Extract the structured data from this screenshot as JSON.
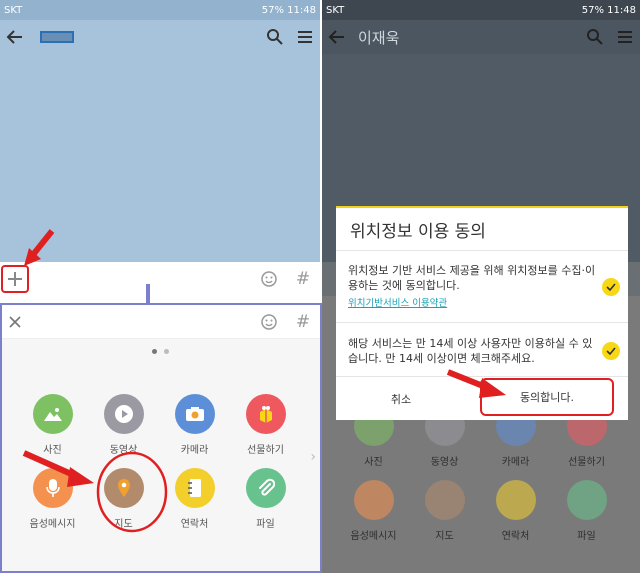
{
  "left": {
    "status": {
      "carrier": "SKT",
      "battery": "57%",
      "time": "11:48"
    },
    "input": {
      "emoji_icon": "emoji-icon",
      "hash_label": "#"
    },
    "drawer": {
      "hash_label": "#",
      "items": [
        {
          "label": "사진",
          "color": "#7dc163"
        },
        {
          "label": "동영상",
          "color": "#9b9aa2"
        },
        {
          "label": "카메라",
          "color": "#5d8fd8"
        },
        {
          "label": "선물하기",
          "color": "#f0585f"
        },
        {
          "label": "음성메시지",
          "color": "#f5914e"
        },
        {
          "label": "지도",
          "color": "#b28a6c"
        },
        {
          "label": "연락처",
          "color": "#f3cf2b"
        },
        {
          "label": "파일",
          "color": "#67c28d"
        }
      ]
    }
  },
  "right": {
    "status": {
      "carrier": "SKT",
      "battery": "57%",
      "time": "11:48"
    },
    "chat_title": "이재욱",
    "dialog": {
      "title": "위치정보 이용 동의",
      "row1": "위치정보 기반 서비스 제공을 위해 위치정보를 수집·이용하는 것에 동의합니다.",
      "row1_link": "위치기반서비스 이용약관",
      "row2": "해당 서비스는 만 14세 이상 사용자만 이용하실 수 있습니다. 만 14세 이상이면 체크해주세요.",
      "cancel": "취소",
      "agree": "동의합니다."
    }
  },
  "colors": {
    "accent": "#f8d716",
    "highlight": "#e02020",
    "drawer_border": "#7c7fcc"
  }
}
